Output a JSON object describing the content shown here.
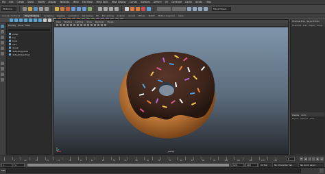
{
  "menubar": {
    "items": [
      "File",
      "Edit",
      "Create",
      "Select",
      "Modify",
      "Display",
      "Windows",
      "Mesh",
      "Edit Mesh",
      "Mesh Tools",
      "Mesh Display",
      "Curves",
      "Surfaces",
      "Deform",
      "UV",
      "Generate",
      "Cache",
      "Arnold",
      "Help"
    ]
  },
  "status_line": {
    "mode": "Modeling",
    "workspace": "Maya Classic"
  },
  "shelf_tabs": [
    "Curves / Surfaces",
    "Poly Modeling",
    "Sculpting",
    "Rigging",
    "Animation",
    "Rendering",
    "FX",
    "FX Caching",
    "Custom",
    "Arnold",
    "Bifrost",
    "MASH",
    "Motion Graphics",
    "XGen"
  ],
  "active_shelf_tab": "Poly Modeling",
  "outliner": {
    "title": "Outliner",
    "menu": [
      "Display",
      "Show",
      "Help"
    ],
    "items": [
      "persp",
      "top",
      "front",
      "side",
      "donut",
      "defaultLightSet",
      "defaultObjectSet"
    ]
  },
  "viewport": {
    "menu": [
      "View",
      "Shading",
      "Lighting",
      "Show",
      "Renderer",
      "Panels"
    ],
    "camera_label": "persp"
  },
  "channel_box": {
    "tabs": [
      "Channel Box / Layer Editor"
    ],
    "menu": [
      "Channels",
      "Edit",
      "Object",
      "Show"
    ],
    "layer_tabs": [
      "Display",
      "Anim"
    ],
    "layer_menu": [
      "Layers",
      "Options",
      "Help"
    ]
  },
  "time_slider": {
    "ticks": [
      "1",
      "5",
      "10",
      "15",
      "20",
      "25",
      "30",
      "35",
      "40",
      "45",
      "50",
      "55",
      "60",
      "65",
      "70",
      "75",
      "80",
      "85",
      "90",
      "95",
      "100",
      "105",
      "110",
      "115",
      "120"
    ],
    "current_frame": "1"
  },
  "range_slider": {
    "start": "1",
    "inner_start": "1",
    "inner_end": "120",
    "end": "200",
    "fps": "24 fps",
    "char_set": "No Character Set",
    "anim_layer": "No Anim Layer"
  },
  "command_line": {
    "label": "MEL"
  },
  "colors": {
    "accent": "#5285a6",
    "donut_icing": "#3b241b",
    "donut_dough": "#c88a4e"
  }
}
